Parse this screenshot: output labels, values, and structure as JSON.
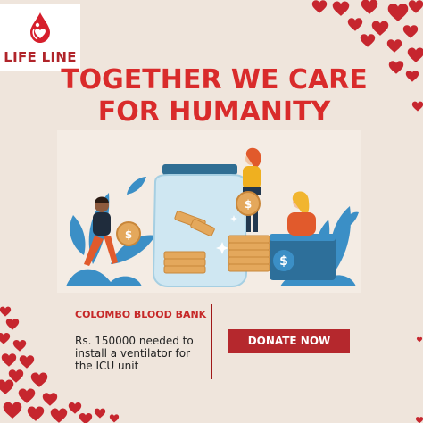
{
  "brand": {
    "name": "LIFE LINE",
    "logo_color": "#d61f2c"
  },
  "headline": {
    "line1": "TOGETHER WE CARE",
    "line2": "FOR HUMANITY",
    "color": "#d92b2b"
  },
  "campaign": {
    "organization": "COLOMBO BLOOD BANK",
    "description": "Rs. 150000 needed to install a ventilator for the ICU unit"
  },
  "cta": {
    "label": "DONATE NOW",
    "color": "#b5282d"
  },
  "illustration": {
    "name": "donation-jar-illustration"
  },
  "decor": {
    "heart_color": "#c6262e",
    "background": "#efe5dc"
  }
}
